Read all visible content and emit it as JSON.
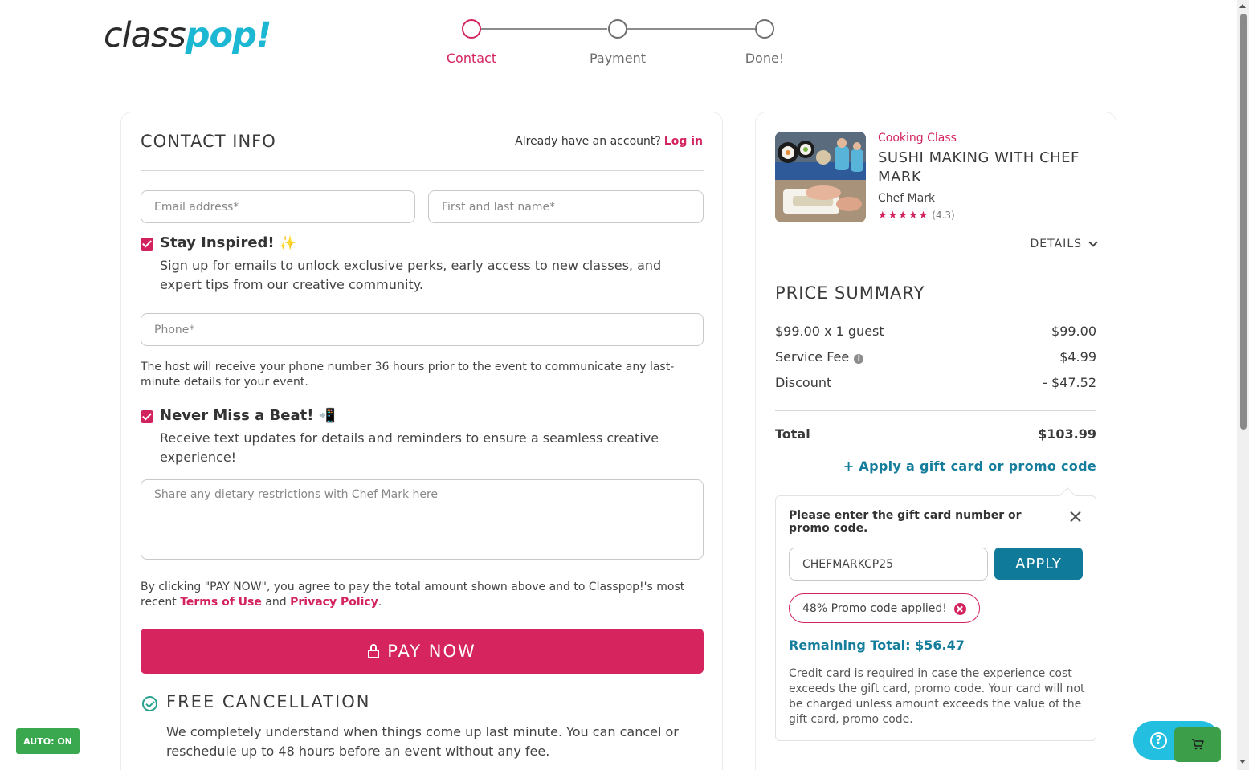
{
  "header": {
    "logo_part1": "class",
    "logo_part2": "pop!",
    "steps": [
      {
        "label": "Contact",
        "active": true
      },
      {
        "label": "Payment",
        "active": false
      },
      {
        "label": "Done!",
        "active": false
      }
    ]
  },
  "contact": {
    "title": "CONTACT INFO",
    "account_prompt": "Already have an account?",
    "login_label": "Log in",
    "email_placeholder": "Email address*",
    "name_placeholder": "First and last name*",
    "stay_inspired": {
      "title": "Stay Inspired!",
      "emoji": "✨",
      "desc": "Sign up for emails to unlock exclusive perks, early access to new classes, and expert tips from our creative community.",
      "checked": true
    },
    "phone_placeholder": "Phone*",
    "phone_note": "The host will receive your phone number 36 hours prior to the event to communicate any last-minute details for your event.",
    "never_miss": {
      "title": "Never Miss a Beat!",
      "emoji": "📲",
      "desc": "Receive text updates for details and reminders to ensure a seamless creative experience!",
      "checked": true
    },
    "dietary_placeholder": "Share any dietary restrictions with Chef Mark here",
    "terms_prefix": "By clicking \"PAY NOW\", you agree to pay the total amount shown above and to Classpop!'s most recent",
    "terms_link": "Terms of Use",
    "terms_and": "and",
    "privacy_link": "Privacy Policy",
    "terms_end": ".",
    "pay_label": "PAY NOW",
    "cancel_title": "FREE CANCELLATION",
    "cancel_desc": "We completely understand when things come up last minute. You can cancel or reschedule up to 48 hours before an event without any fee."
  },
  "summary": {
    "category": "Cooking Class",
    "class_title": "SUSHI MAKING WITH CHEF MARK",
    "chef": "Chef Mark",
    "stars": "★★★★★",
    "rating": "(4.3)",
    "details_label": "DETAILS",
    "price_title": "PRICE SUMMARY",
    "lines": [
      {
        "label": "$99.00 x 1 guest",
        "value": "$99.00"
      },
      {
        "label": "Service Fee",
        "value": "$4.99"
      },
      {
        "label": "Discount",
        "value": "- $47.52"
      }
    ],
    "total_label": "Total",
    "total_value": "$103.99",
    "promo_link": "+ Apply a gift card or promo code",
    "promo_prompt": "Please enter the gift card number or promo code.",
    "promo_value": "CHEFMARKCP25",
    "apply_label": "APPLY",
    "applied_chip": "48% Promo code applied!",
    "remaining": "Remaining Total: $56.47",
    "cc_note": "Credit card is required in case the experience cost exceeds the gift card, promo code. Your card will not be charged unless amount exceeds the value of the gift card, promo code."
  },
  "floating": {
    "auto_label": "AUTO: ON",
    "help_glyph": "?"
  },
  "colors": {
    "brand_pink": "#d3235f",
    "brand_teal": "#147d9c",
    "logo_cyan": "#1cb7d2"
  }
}
